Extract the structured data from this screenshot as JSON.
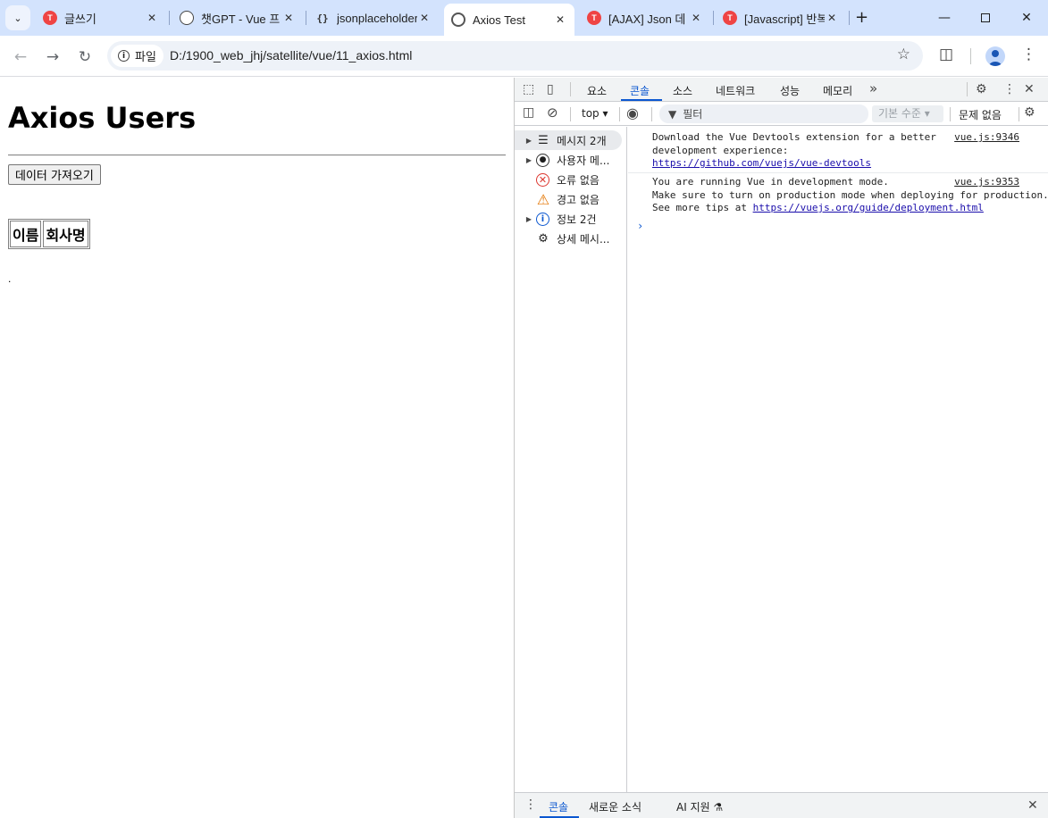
{
  "browser": {
    "tab_search_icon": "chevron-down-icon",
    "tabs": [
      {
        "title": "글쓰기",
        "favicon": "tistory-icon"
      },
      {
        "title": "챗GPT - Vue 프",
        "favicon": "chatgpt-icon"
      },
      {
        "title": "jsonplaceholder",
        "favicon": "json-icon"
      },
      {
        "title": "Axios Test",
        "favicon": "globe-icon",
        "active": true
      },
      {
        "title": "[AJAX] Json 데",
        "favicon": "tistory-icon"
      },
      {
        "title": "[Javascript] 반복",
        "favicon": "tistory-icon"
      }
    ],
    "site_chip": "파일",
    "url": "D:/1900_web_jhj/satellite/vue/11_axios.html"
  },
  "page": {
    "heading": "Axios Users",
    "fetch_button": "데이터 가져오기",
    "table_headers": [
      "이름",
      "회사명"
    ],
    "trailing_text": "."
  },
  "devtools": {
    "tabs": [
      "요소",
      "콘솔",
      "소스",
      "네트워크",
      "성능",
      "메모리"
    ],
    "active_tab": "콘솔",
    "context": "top",
    "filter_placeholder": "필터",
    "level": "기본 수준",
    "issues": "문제 없음",
    "sidebar": [
      {
        "label": "메시지 2개",
        "icon": "list-icon",
        "expandable": true,
        "selected": true
      },
      {
        "label": "사용자 메...",
        "icon": "user-icon",
        "expandable": true
      },
      {
        "label": "오류 없음",
        "icon": "error-icon",
        "expandable": false
      },
      {
        "label": "경고 없음",
        "icon": "warning-icon",
        "expandable": false
      },
      {
        "label": "정보 2건",
        "icon": "info-icon",
        "expandable": true
      },
      {
        "label": "상세 메시...",
        "icon": "bug-icon",
        "expandable": false
      }
    ],
    "messages": [
      {
        "lines": [
          "Download the Vue Devtools extension for a better",
          "development experience:"
        ],
        "link": "https://github.com/vuejs/vue-devtools",
        "source": "vue.js:9346"
      },
      {
        "lines": [
          "You are running Vue in development mode.",
          "Make sure to turn on production mode when deploying for production."
        ],
        "trail_prefix": "See more tips at ",
        "link": "https://vuejs.org/guide/deployment.html",
        "source": "vue.js:9353"
      }
    ],
    "drawer_tabs": [
      "콘솔",
      "새로운 소식",
      "AI 지원"
    ]
  },
  "colors": {
    "tabstrip": "#d3e3fd",
    "accent": "#0b57d0",
    "error": "#dc362e",
    "warning": "#e37400"
  }
}
